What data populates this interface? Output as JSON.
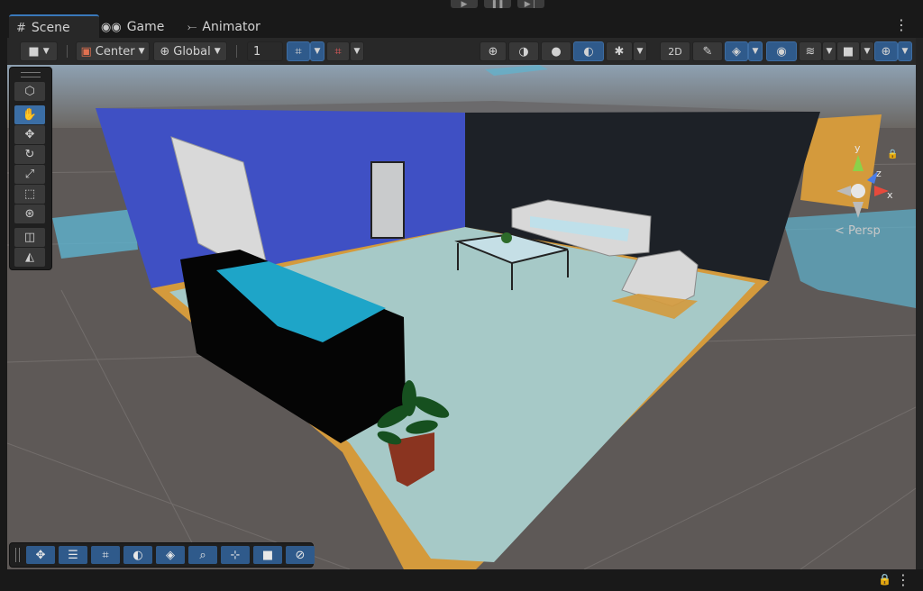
{
  "playbar": {
    "play_icon": "play-icon",
    "pause_icon": "pause-icon",
    "step_icon": "step-icon"
  },
  "tabs": [
    {
      "label": "Scene",
      "icon": "grid-icon",
      "active": true
    },
    {
      "label": "Game",
      "icon": "gamepad-icon",
      "active": false
    },
    {
      "label": "Animator",
      "icon": "animator-icon",
      "active": false
    }
  ],
  "toolbar": {
    "pivot_mode": "Center",
    "pivot_rotation": "Global",
    "grid_increment": "1"
  },
  "gizmo": {
    "persp_label": "Persp",
    "axis_x": "x",
    "axis_y": "y",
    "axis_z": "z"
  },
  "colors": {
    "accent": "#3a79bb",
    "selected_tool": "#3b6ea5",
    "floor": "#a6c9c7",
    "wall_blue": "#3f50c4"
  }
}
